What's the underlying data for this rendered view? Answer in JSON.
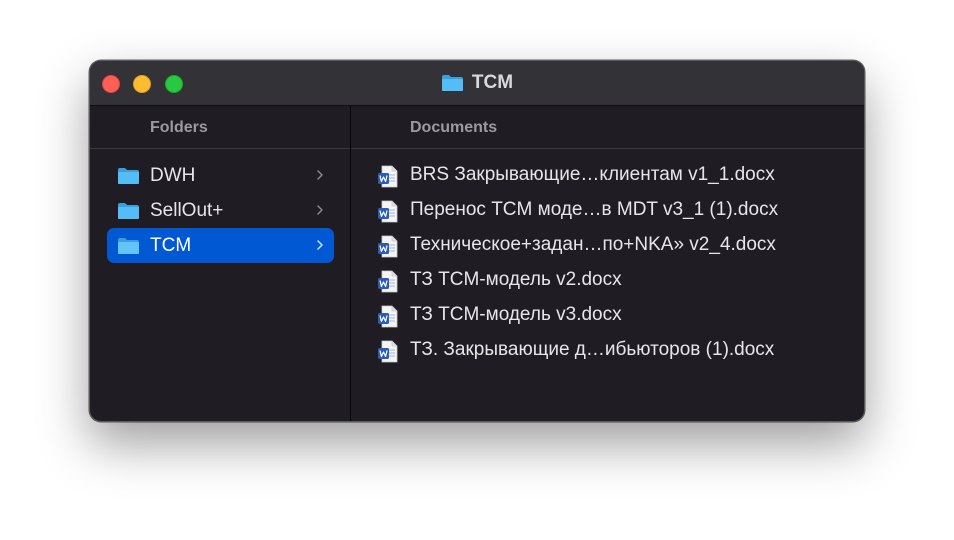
{
  "window": {
    "title": "TCM",
    "title_icon": "folder-icon"
  },
  "sidebar": {
    "header": "Folders",
    "items": [
      {
        "label": "DWH",
        "icon": "folder-icon",
        "selected": false
      },
      {
        "label": "SellOut+",
        "icon": "folder-icon",
        "selected": false
      },
      {
        "label": "TCM",
        "icon": "folder-icon",
        "selected": true
      }
    ]
  },
  "documents": {
    "header": "Documents",
    "items": [
      {
        "label": "BRS Закрывающие…клиентам v1_1.docx",
        "icon": "word-document-icon"
      },
      {
        "label": "Перенос TCM моде…в MDT v3_1 (1).docx",
        "icon": "word-document-icon"
      },
      {
        "label": "Техническое+задан…по+NKA» v2_4.docx",
        "icon": "word-document-icon"
      },
      {
        "label": "ТЗ TCM-модель v2.docx",
        "icon": "word-document-icon"
      },
      {
        "label": "ТЗ TCM-модель v3.docx",
        "icon": "word-document-icon"
      },
      {
        "label": "ТЗ. Закрывающие д…ибьюторов (1).docx",
        "icon": "word-document-icon"
      }
    ]
  },
  "colors": {
    "selection": "#0059d2",
    "window_bg": "#1f1d23",
    "titlebar_bg": "#333236",
    "folder_blue": "#4fb6f2",
    "word_blue": "#2b5cb5"
  }
}
